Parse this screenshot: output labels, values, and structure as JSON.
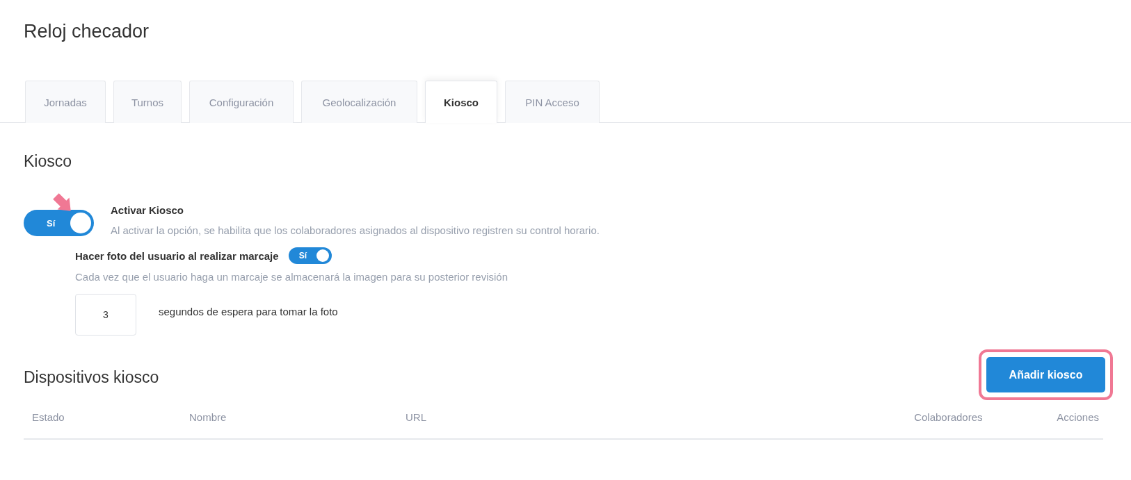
{
  "page": {
    "title": "Reloj checador"
  },
  "tabs": [
    {
      "label": "Jornadas",
      "selected": false
    },
    {
      "label": "Turnos",
      "selected": false
    },
    {
      "label": "Configuración",
      "selected": false
    },
    {
      "label": "Geolocalización",
      "selected": false
    },
    {
      "label": "Kiosco",
      "selected": true
    },
    {
      "label": "PIN Acceso",
      "selected": false
    }
  ],
  "section": {
    "title": "Kiosco"
  },
  "kiosk_toggle": {
    "on": true,
    "state_label": "Sí",
    "label": "Activar Kiosco",
    "description": "Al activar la opción, se habilita que los colaboradores asignados al dispositivo registren su control horario.",
    "annotated": true
  },
  "photo_toggle": {
    "label": "Hacer foto del usuario al realizar marcaje",
    "on": true,
    "state_label": "Sí",
    "description": "Cada vez que el usuario haga un marcaje se almacenará la imagen para su posterior revisión"
  },
  "delay": {
    "value": "3",
    "label": "segundos de espera para tomar la foto"
  },
  "devices": {
    "title": "Dispositivos kiosco",
    "add_button": "Añadir kiosco",
    "button_highlighted": true,
    "columns": [
      "Estado",
      "Nombre",
      "URL",
      "Colaboradores",
      "Acciones"
    ]
  }
}
